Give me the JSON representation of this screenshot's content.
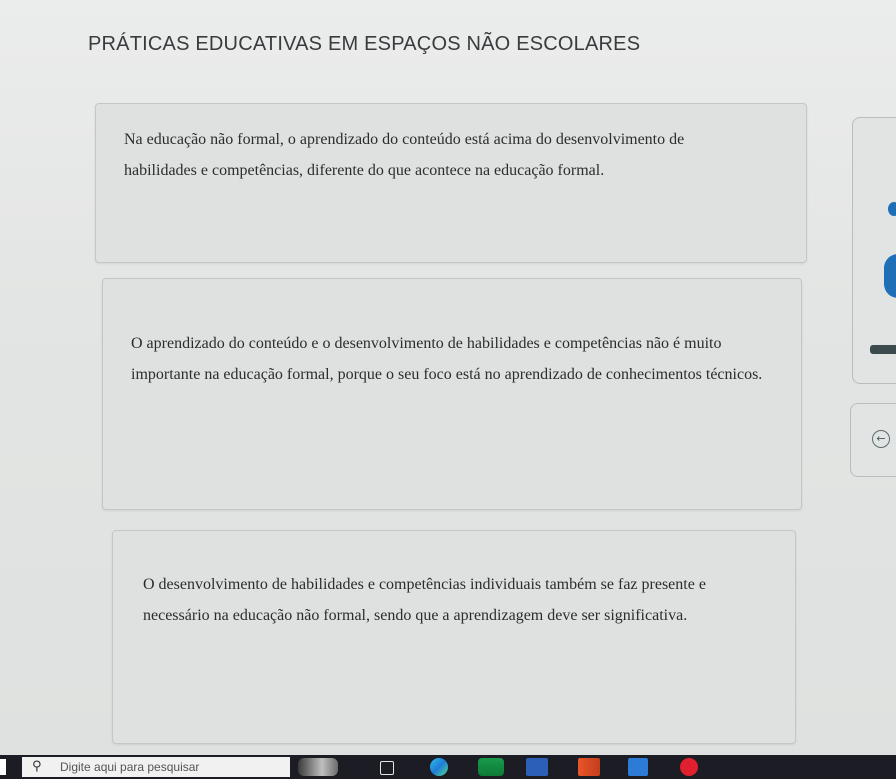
{
  "page": {
    "title": "PRÁTICAS EDUCATIVAS EM ESPAÇOS NÃO ESCOLARES"
  },
  "options": [
    {
      "text": "Na educação não formal, o aprendizado do conteúdo está acima do desenvolvimento de habilidades e competências, diferente do que acontece na educação formal."
    },
    {
      "text": "O aprendizado do conteúdo e o desenvolvimento de habilidades e competências não é muito importante na educação formal, porque o seu foco está no aprendizado de conhecimentos técnicos."
    },
    {
      "text": "O desenvolvimento de habilidades e competências individuais também se faz presente e necessário na educação não formal, sendo que a aprendizagem deve ser significativa."
    }
  ],
  "side_controls": {
    "back_icon": "back-arrow-icon",
    "accent_color": "#1f6fb6"
  },
  "taskbar": {
    "search_placeholder": "Digite aqui para pesquisar",
    "search_icon": "search-icon",
    "apps": [
      "weather-widget",
      "task-view",
      "edge",
      "teams",
      "word",
      "powerpoint",
      "calendar",
      "opera"
    ]
  }
}
